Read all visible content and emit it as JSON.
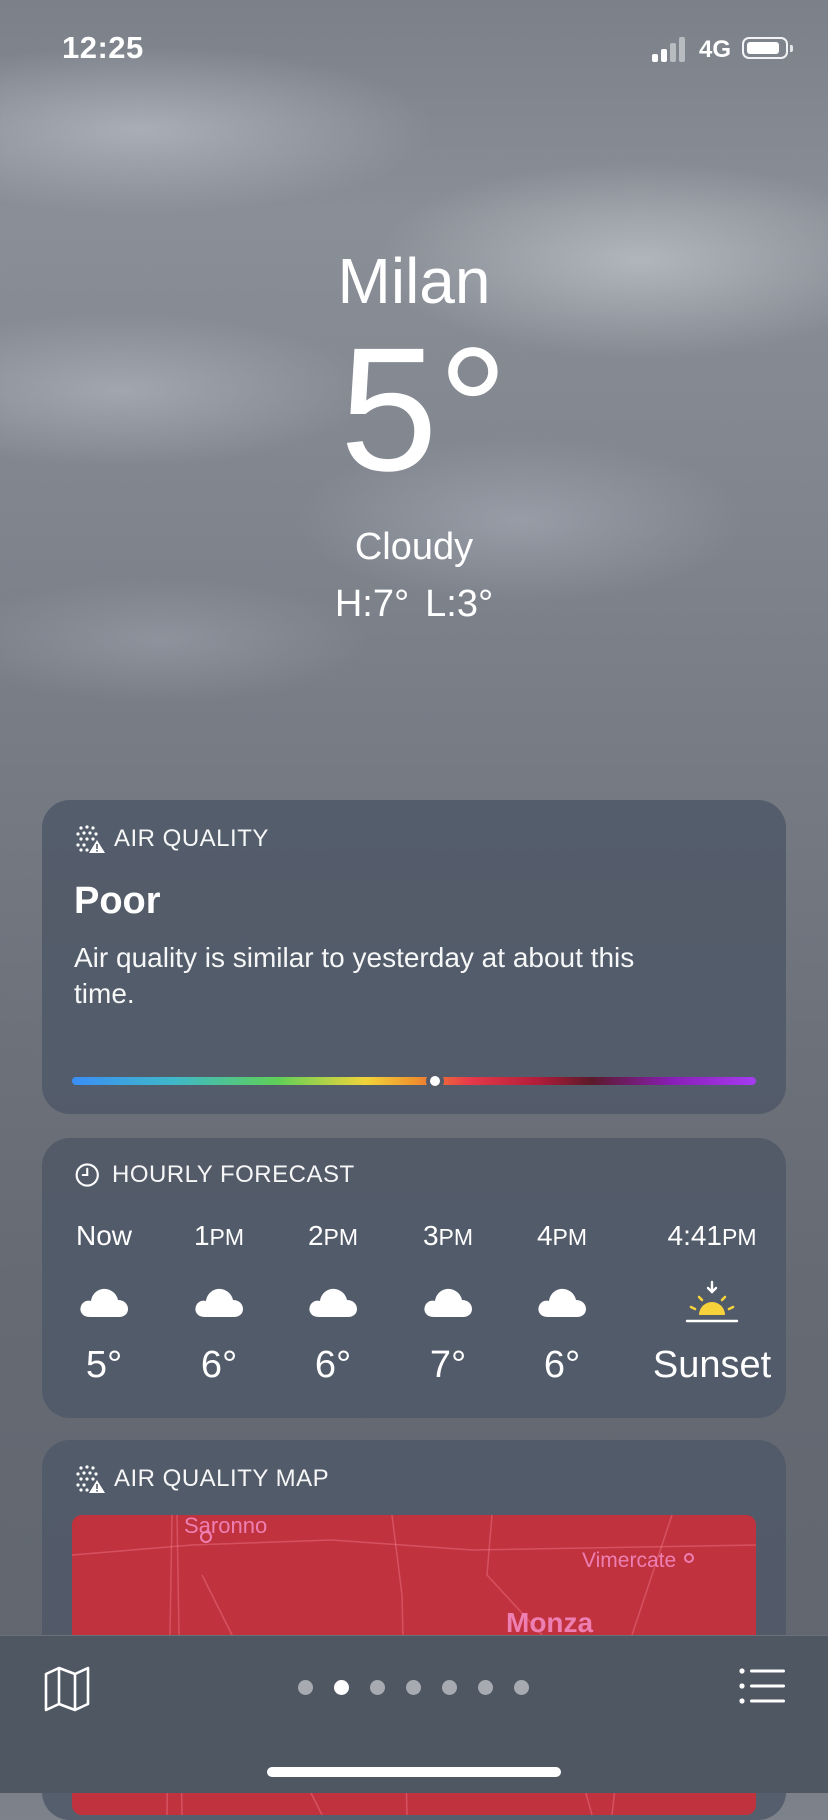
{
  "status_bar": {
    "time": "12:25",
    "network": "4G"
  },
  "location": {
    "city": "Milan",
    "temperature": "5°",
    "condition": "Cloudy",
    "high": "H:7°",
    "low": "L:3°"
  },
  "air_quality": {
    "header": "AIR QUALITY",
    "level": "Poor",
    "description": "Air quality is similar to yesterday at about this time.",
    "scale_position_percent": 53
  },
  "hourly_forecast": {
    "header": "HOURLY FORECAST",
    "hours": [
      {
        "label": "Now",
        "suffix": "",
        "icon": "cloud-icon",
        "value": "5°"
      },
      {
        "label": "1",
        "suffix": "PM",
        "icon": "cloud-icon",
        "value": "6°"
      },
      {
        "label": "2",
        "suffix": "PM",
        "icon": "cloud-icon",
        "value": "6°"
      },
      {
        "label": "3",
        "suffix": "PM",
        "icon": "cloud-icon",
        "value": "7°"
      },
      {
        "label": "4",
        "suffix": "PM",
        "icon": "cloud-icon",
        "value": "6°"
      },
      {
        "label": "4:41",
        "suffix": "PM",
        "icon": "sunset-icon",
        "value": "Sunset"
      }
    ]
  },
  "air_quality_map": {
    "header": "AIR QUALITY MAP",
    "places": [
      "Saronno",
      "Vimercate",
      "Monza"
    ],
    "fill_color": "#c0323e"
  },
  "tab_bar": {
    "page_count": 7,
    "active_page": 2
  }
}
